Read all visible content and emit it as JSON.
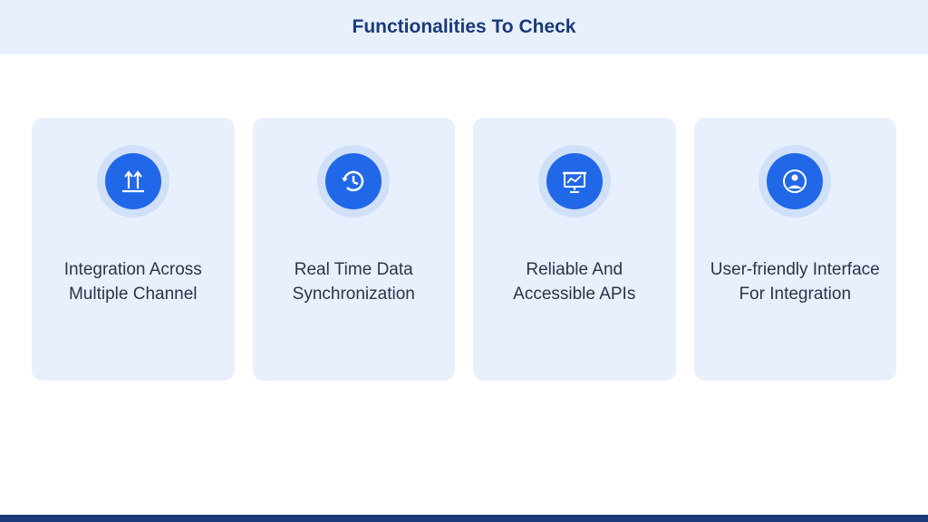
{
  "header": {
    "title": "Functionalities To Check"
  },
  "cards": [
    {
      "icon": "upload-arrows-icon",
      "label": "Integration Across Multiple Channel"
    },
    {
      "icon": "history-icon",
      "label": "Real Time Data Synchronization"
    },
    {
      "icon": "presentation-chart-icon",
      "label": "Reliable And Accessible APIs"
    },
    {
      "icon": "user-circle-icon",
      "label": "User-friendly Interface For Integration"
    }
  ],
  "colors": {
    "header_bg": "#e8f0fe",
    "header_text": "#1a3a7a",
    "card_bg": "#e8f0fe",
    "icon_outer": "#d0e0f8",
    "icon_inner": "#2168e8",
    "card_text": "#2a3548",
    "bottom_bar": "#1a3a7a"
  }
}
